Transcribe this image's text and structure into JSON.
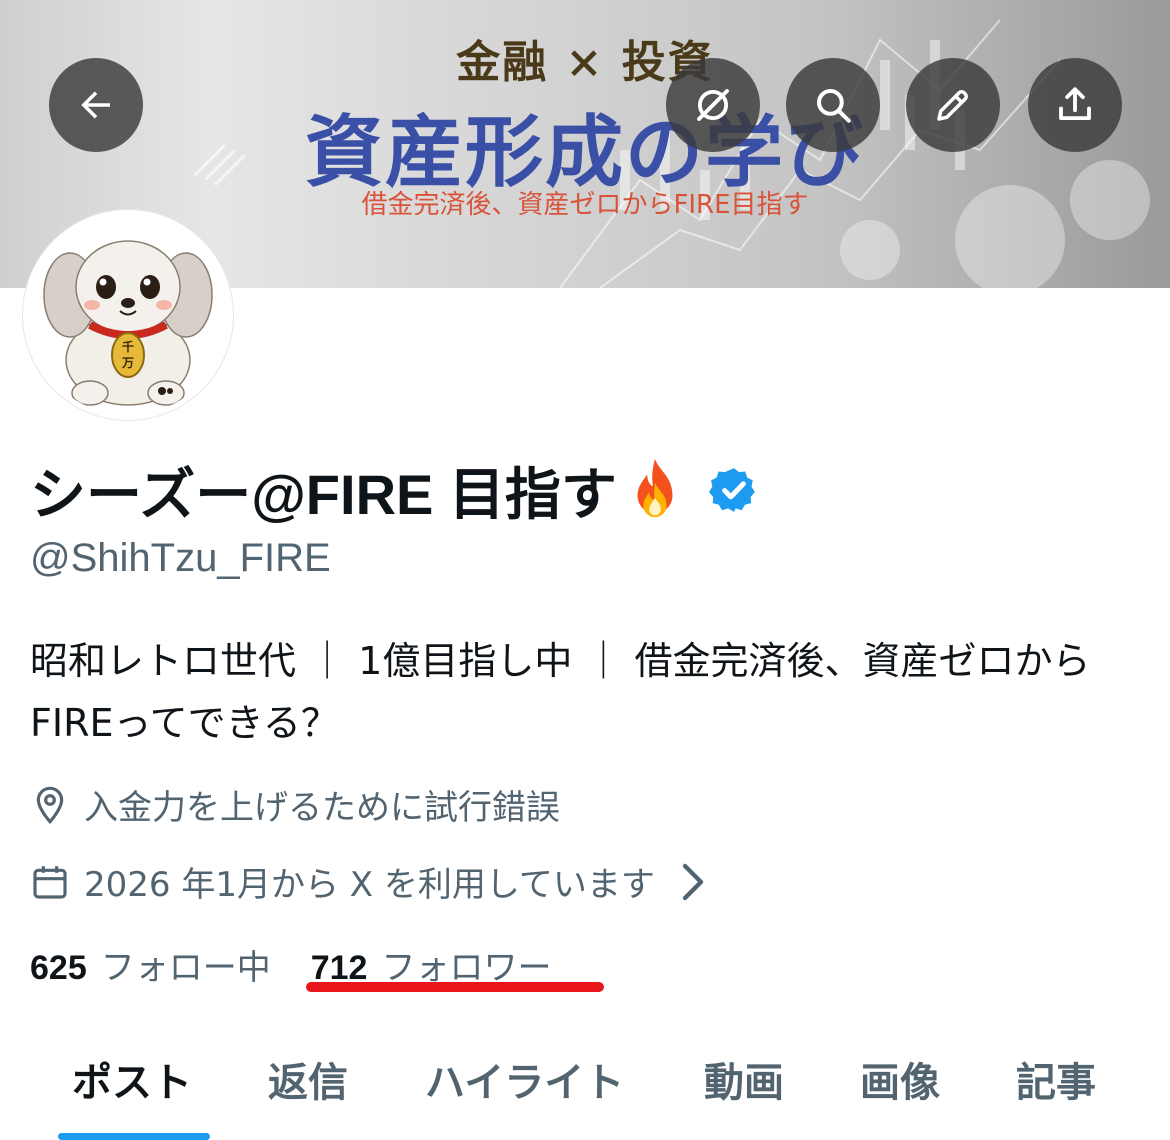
{
  "banner": {
    "top_text": "金融 × 投資",
    "main_text": "資産形成の学び",
    "sub_text": "借金完済後、資産ゼロからFIRE目指す"
  },
  "header_buttons": [
    {
      "icon": "back-arrow-icon"
    },
    {
      "icon": "grok-icon"
    },
    {
      "icon": "search-icon"
    },
    {
      "icon": "edit-pencil-icon"
    },
    {
      "icon": "share-icon"
    }
  ],
  "profile": {
    "display_name": "シーズー@FIRE 目指す",
    "name_emoji": "fire-icon",
    "verified": true,
    "handle": "@ShihTzu_FIRE",
    "bio": "昭和レトロ世代 ｜ 1億目指し中 ｜ 借金完済後、資産ゼロからFIREってできる？",
    "location": "入金力を上げるために試行錯誤",
    "joined": "2026 年1月から X を利用しています"
  },
  "stats": {
    "following_count": "625",
    "following_label": "フォロー中",
    "followers_count": "712",
    "followers_label": "フォロワー"
  },
  "tabs": [
    {
      "label": "ポスト",
      "active": true
    },
    {
      "label": "返信",
      "active": false
    },
    {
      "label": "ハイライト",
      "active": false
    },
    {
      "label": "動画",
      "active": false
    },
    {
      "label": "画像",
      "active": false
    },
    {
      "label": "記事",
      "active": false
    }
  ],
  "colors": {
    "accent": "#1d9bf0",
    "verified": "#1d9bf0",
    "annotation_underline": "#e8151b",
    "secondary_text": "#536471"
  }
}
